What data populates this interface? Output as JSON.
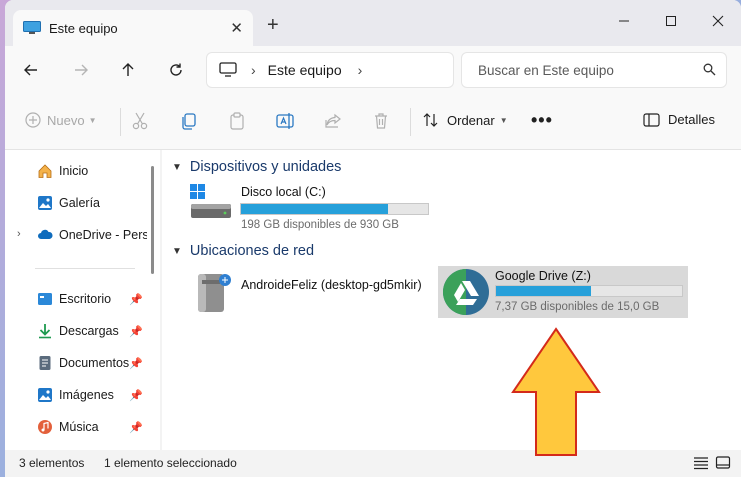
{
  "window": {
    "tab_title": "Este equipo",
    "close_tab": "✕",
    "new_tab": "+"
  },
  "address_bar": {
    "location": "Este equipo",
    "search_placeholder": "Buscar en Este equipo"
  },
  "toolbar": {
    "new_label": "Nuevo",
    "sort_label": "Ordenar",
    "more_label": "•••",
    "details_label": "Detalles"
  },
  "sidebar": {
    "items": [
      {
        "label": "Inicio",
        "icon": "home-icon"
      },
      {
        "label": "Galería",
        "icon": "gallery-icon"
      },
      {
        "label": "OneDrive - Personal",
        "icon": "onedrive-icon"
      },
      {
        "label": "Escritorio",
        "icon": "desktop-icon",
        "pinned": true
      },
      {
        "label": "Descargas",
        "icon": "downloads-icon",
        "pinned": true
      },
      {
        "label": "Documentos",
        "icon": "documents-icon",
        "pinned": true
      },
      {
        "label": "Imágenes",
        "icon": "pictures-icon",
        "pinned": true
      },
      {
        "label": "Música",
        "icon": "music-icon",
        "pinned": true
      }
    ]
  },
  "content": {
    "groups": [
      {
        "title": "Dispositivos y unidades"
      },
      {
        "title": "Ubicaciones de red"
      }
    ],
    "local_disk": {
      "name": "Disco local (C:)",
      "free_text": "198 GB disponibles de 930 GB",
      "used_fraction": 0.787
    },
    "network_share": {
      "name": "AndroideFeliz (desktop-gd5mkir)"
    },
    "google_drive": {
      "name": "Google Drive (Z:)",
      "free_text": "7,37 GB disponibles de 15,0 GB",
      "used_fraction": 0.509
    }
  },
  "status": {
    "item_count": "3 elementos",
    "selected": "1 elemento seleccionado"
  },
  "colors": {
    "accent": "#26a0da",
    "arrow_fill": "#ffc83d",
    "arrow_stroke": "#d42a1a"
  }
}
